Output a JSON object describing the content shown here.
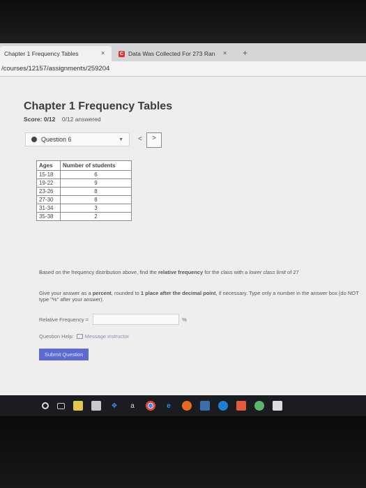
{
  "browser": {
    "tabs": [
      {
        "label": "Chapter 1 Frequency Tables",
        "close": "×"
      },
      {
        "label": "Data Was Collected For 273 Ran",
        "close": "×",
        "favicon": "C"
      }
    ],
    "new_tab": "+",
    "url": "/courses/12157/assignments/259204"
  },
  "page": {
    "title": "Chapter 1 Frequency Tables",
    "score_label": "Score:",
    "score_value": "0/12",
    "answered": "0/12 answered"
  },
  "question": {
    "selector_label": "Question 6",
    "prev": "<",
    "next": ">"
  },
  "table": {
    "headers": [
      "Ages",
      "Number of students"
    ],
    "rows": [
      {
        "age": "15-18",
        "count": "6"
      },
      {
        "age": "19-22",
        "count": "9"
      },
      {
        "age": "23-26",
        "count": "8"
      },
      {
        "age": "27-30",
        "count": "8"
      },
      {
        "age": "31-34",
        "count": "3"
      },
      {
        "age": "35-38",
        "count": "2"
      }
    ]
  },
  "prompt": {
    "p1_a": "Based on the frequency distribution above, find the ",
    "p1_b": "relative frequency",
    "p1_c": " for the class with a ",
    "p1_d": "lower class limit",
    "p1_e": " of 27",
    "p2_a": "Give your answer as a ",
    "p2_b": "percent",
    "p2_c": ", rounded to ",
    "p2_d": "1 place after the decimal point",
    "p2_e": ", if necessary. Type only a number in the answer box (do NOT type \"%\" after your answer)."
  },
  "answer": {
    "label": "Relative Frequency =",
    "unit": "%",
    "value": ""
  },
  "help": {
    "label": "Question Help:",
    "link": "Message instructor"
  },
  "submit_label": "Submit Question",
  "colors": {
    "accent": "#5c6bd3",
    "link": "#8c8fb8"
  },
  "taskbar_icons": [
    "cortana-icon",
    "task-view-icon",
    "file-explorer-icon",
    "store-icon",
    "dropbox-icon",
    "amazon-icon",
    "chrome-icon",
    "edge-icon",
    "firefox-icon",
    "photos-icon",
    "app-icon",
    "app-icon",
    "app-icon"
  ]
}
